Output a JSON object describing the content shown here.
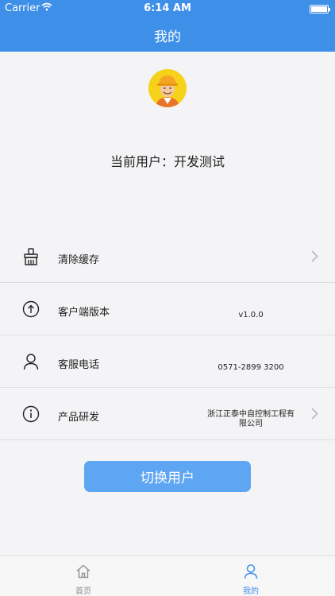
{
  "status_bar": {
    "carrier": "Carrier",
    "time": "6:14 AM"
  },
  "nav": {
    "title": "我的"
  },
  "profile": {
    "current_user": "当前用户：开发测试"
  },
  "menu": [
    {
      "label": "清除缓存",
      "value": "",
      "icon": "broom-icon",
      "has_chevron": true
    },
    {
      "label": "客户端版本",
      "value": "v1.0.0",
      "icon": "arrow-up-circle-icon",
      "has_chevron": false
    },
    {
      "label": "客服电话",
      "value": "0571-2899 3200",
      "icon": "person-icon",
      "has_chevron": false
    },
    {
      "label": "产品研发",
      "value_line1": "浙江正泰中自控制工程有",
      "value_line2": "限公司",
      "icon": "info-circle-icon",
      "has_chevron": true
    }
  ],
  "switch_user": {
    "label": "切换用户"
  },
  "tabs": [
    {
      "label": "首页",
      "icon": "home-icon",
      "active": false
    },
    {
      "label": "我的",
      "icon": "person-icon",
      "active": true
    }
  ],
  "colors": {
    "primary": "#3d8fe8",
    "button": "#5ea6f3",
    "tab_active": "#3d8fe8",
    "tab_inactive": "#8e8e93"
  }
}
